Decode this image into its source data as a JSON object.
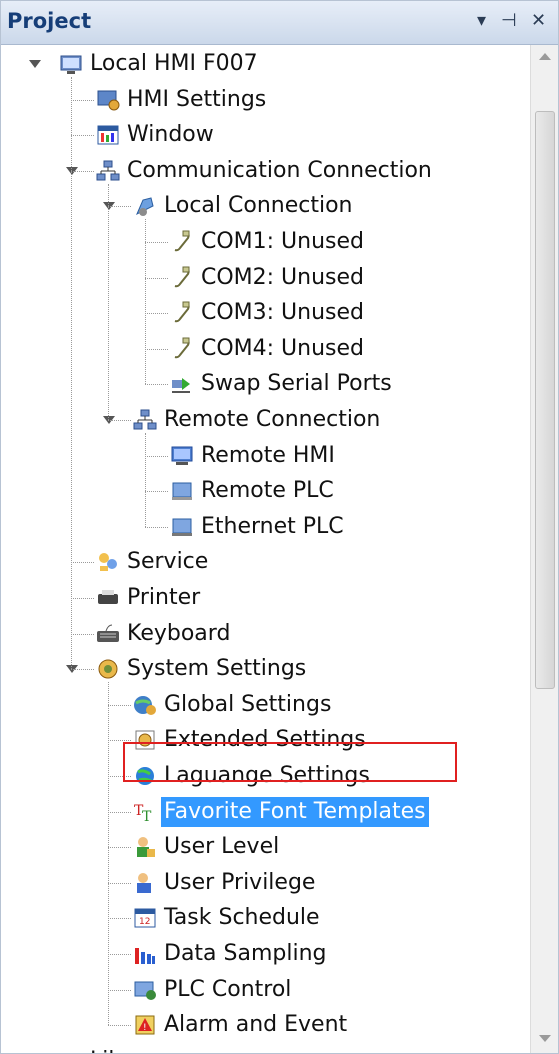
{
  "panel": {
    "title": "Project",
    "pin_glyph": "⊣",
    "close_glyph": "✕",
    "menu_glyph": "▾"
  },
  "tree": [
    {
      "label": "Local HMI F007",
      "icon": "monitor-icon",
      "level": 0,
      "expander": "expanded"
    },
    {
      "label": "HMI Settings",
      "icon": "hmi-settings-icon",
      "level": 1
    },
    {
      "label": "Window",
      "icon": "window-icon",
      "level": 1
    },
    {
      "label": "Communication Connection",
      "icon": "network-icon",
      "level": 1,
      "expander": "expanded"
    },
    {
      "label": "Local Connection",
      "icon": "local-connection-icon",
      "level": 2,
      "expander": "expanded"
    },
    {
      "label": "COM1: Unused",
      "icon": "serial-cable-icon",
      "level": 3
    },
    {
      "label": "COM2: Unused",
      "icon": "serial-cable-icon",
      "level": 3
    },
    {
      "label": "COM3: Unused",
      "icon": "serial-cable-icon",
      "level": 3
    },
    {
      "label": "COM4: Unused",
      "icon": "serial-cable-icon",
      "level": 3
    },
    {
      "label": "Swap Serial Ports",
      "icon": "swap-ports-icon",
      "level": 3
    },
    {
      "label": "Remote Connection",
      "icon": "network-icon",
      "level": 2,
      "expander": "expanded"
    },
    {
      "label": "Remote HMI",
      "icon": "remote-hmi-icon",
      "level": 3
    },
    {
      "label": "Remote PLC",
      "icon": "remote-plc-icon",
      "level": 3
    },
    {
      "label": "Ethernet PLC",
      "icon": "ethernet-plc-icon",
      "level": 3
    },
    {
      "label": "Service",
      "icon": "service-icon",
      "level": 1
    },
    {
      "label": "Printer",
      "icon": "printer-icon",
      "level": 1
    },
    {
      "label": "Keyboard",
      "icon": "keyboard-icon",
      "level": 1
    },
    {
      "label": "System Settings",
      "icon": "system-settings-icon",
      "level": 1,
      "expander": "expanded"
    },
    {
      "label": "Global Settings",
      "icon": "global-settings-icon",
      "level": 2
    },
    {
      "label": "Extended Settings",
      "icon": "extended-settings-icon",
      "level": 2
    },
    {
      "label": "Laguange Settings",
      "icon": "globe-icon",
      "level": 2
    },
    {
      "label": "Favorite Font Templates",
      "icon": "font-icon",
      "level": 2,
      "selected": true
    },
    {
      "label": "User Level",
      "icon": "user-level-icon",
      "level": 2
    },
    {
      "label": "User Privilege",
      "icon": "user-privilege-icon",
      "level": 2
    },
    {
      "label": "Task Schedule",
      "icon": "calendar-icon",
      "level": 2
    },
    {
      "label": "Data Sampling",
      "icon": "bar-chart-icon",
      "level": 2
    },
    {
      "label": "PLC Control",
      "icon": "plc-control-icon",
      "level": 2
    },
    {
      "label": "Alarm and Event",
      "icon": "alarm-icon",
      "level": 2
    },
    {
      "label": "Library",
      "icon": "library-icon",
      "level": 0
    }
  ],
  "colors": {
    "selection": "#3399ff",
    "highlight_box": "#e02020",
    "title_text": "#163e78"
  }
}
